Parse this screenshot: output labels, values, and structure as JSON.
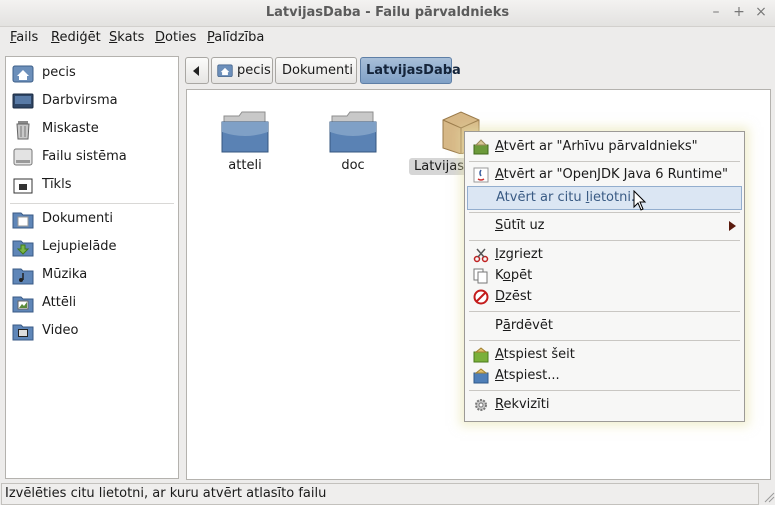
{
  "window": {
    "title": "LatvijasDaba - Failu pārvaldnieks"
  },
  "menubar": {
    "items": [
      {
        "pre": "",
        "acc": "F",
        "post": "ails"
      },
      {
        "pre": "",
        "acc": "R",
        "post": "ediģēt"
      },
      {
        "pre": "",
        "acc": "S",
        "post": "kats"
      },
      {
        "pre": "",
        "acc": "D",
        "post": "oties"
      },
      {
        "pre": "",
        "acc": "P",
        "post": "alīdzība"
      }
    ]
  },
  "sidebar": {
    "items": [
      {
        "label": "pecis",
        "icon": "home-icon"
      },
      {
        "label": "Darbvirsma",
        "icon": "desktop-icon"
      },
      {
        "label": "Miskaste",
        "icon": "trash-icon"
      },
      {
        "label": "Failu sistēma",
        "icon": "drive-icon"
      },
      {
        "label": "Tīkls",
        "icon": "network-icon"
      },
      {
        "label": "Dokumenti",
        "icon": "documents-folder-icon"
      },
      {
        "label": "Lejupielāde",
        "icon": "downloads-folder-icon"
      },
      {
        "label": "Mūzika",
        "icon": "music-folder-icon"
      },
      {
        "label": "Attēli",
        "icon": "pictures-folder-icon"
      },
      {
        "label": "Video",
        "icon": "video-folder-icon"
      }
    ]
  },
  "pathbar": {
    "crumbs": [
      "pecis",
      "Dokumenti",
      "LatvijasDaba"
    ]
  },
  "files": [
    {
      "name": "atteli",
      "type": "folder"
    },
    {
      "name": "doc",
      "type": "folder"
    },
    {
      "name": "LatvijasD",
      "type": "archive"
    }
  ],
  "context_menu": {
    "items": [
      {
        "pre": "",
        "acc": "A",
        "post": "tvērt ar \"Arhīvu pārvaldnieks\"",
        "icon": "archive-manager-icon"
      },
      {
        "pre": "",
        "acc": "A",
        "post": "tvērt ar \"OpenJDK Java 6 Runtime\"",
        "icon": "java-icon"
      },
      {
        "pre": "Atvērt ar citu ",
        "acc": "l",
        "post": "ietotni...",
        "icon": ""
      },
      {
        "pre": "",
        "acc": "S",
        "post": "ūtīt uz",
        "icon": ""
      },
      {
        "pre": "",
        "acc": "I",
        "post": "zgriezt",
        "icon": "scissors-icon"
      },
      {
        "pre": "K",
        "acc": "o",
        "post": "pēt",
        "icon": "copy-icon"
      },
      {
        "pre": "",
        "acc": "D",
        "post": "zēst",
        "icon": "delete-icon"
      },
      {
        "pre": "P",
        "acc": "ā",
        "post": "rdēvēt",
        "icon": ""
      },
      {
        "pre": "",
        "acc": "A",
        "post": "tspiest šeit",
        "icon": "extract-here-icon"
      },
      {
        "pre": "",
        "acc": "A",
        "post": "tspiest...",
        "icon": "extract-icon"
      },
      {
        "pre": "",
        "acc": "R",
        "post": "ekvizīti",
        "icon": "properties-gear-icon"
      }
    ]
  },
  "statusbar": {
    "text": "Izvēlēties citu lietotni, ar kuru atvērt atlasīto failu"
  },
  "colors": {
    "accent_blue": "#7fa0c6",
    "hover_highlight": "#dbe6f3",
    "folder_blue": "#5a82b4"
  }
}
